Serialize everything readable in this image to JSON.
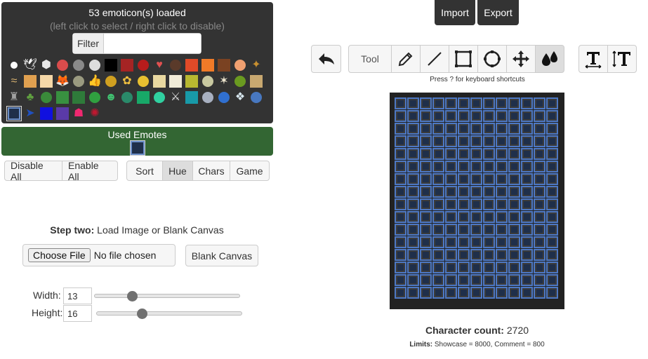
{
  "emotes": {
    "loaded_text": "53 emoticon(s) loaded",
    "hint_text": "(left click to select / right click to disable)",
    "filter_label": "Filter",
    "filter_value": "",
    "items": [
      {
        "name": "white-circle-emote",
        "shape": "sm",
        "color": "#ffffff"
      },
      {
        "name": "white-bird-emote",
        "shape": "glyph",
        "glyph": "🕊",
        "color": "#ffffff"
      },
      {
        "name": "white-cube-emote",
        "shape": "glyph",
        "glyph": "⬢",
        "color": "#e8e8e8"
      },
      {
        "name": "red-circle-emote",
        "shape": "ci",
        "color": "#d94c4c"
      },
      {
        "name": "grey-face-emote",
        "shape": "ci",
        "color": "#8a8a8a"
      },
      {
        "name": "panda-emote",
        "shape": "ci",
        "color": "#dddddd"
      },
      {
        "name": "black-square-emote",
        "shape": "sq",
        "color": "#000000"
      },
      {
        "name": "dark-red-square-emote",
        "shape": "sq",
        "color": "#a52424"
      },
      {
        "name": "red-swirl-emote",
        "shape": "ci",
        "color": "#b71c1c"
      },
      {
        "name": "heart-emote",
        "shape": "glyph",
        "glyph": "♥",
        "color": "#e05050"
      },
      {
        "name": "brown-dot-emote",
        "shape": "ci",
        "color": "#5a3a2a"
      },
      {
        "name": "orange-red-square-emote",
        "shape": "sq",
        "color": "#e04a28"
      },
      {
        "name": "orange-square-emote",
        "shape": "sq",
        "color": "#f07a28"
      },
      {
        "name": "brown-square-emote",
        "shape": "sq",
        "color": "#7a4222"
      },
      {
        "name": "peach-circle-emote",
        "shape": "ci",
        "color": "#f0a070"
      },
      {
        "name": "beetle-emote",
        "shape": "glyph",
        "glyph": "✦",
        "color": "#c89030"
      },
      {
        "name": "bone-emote",
        "shape": "glyph",
        "glyph": "≈",
        "color": "#d6b070"
      },
      {
        "name": "orange-tan-square-emote",
        "shape": "sq",
        "color": "#e0a050"
      },
      {
        "name": "cream-square-emote",
        "shape": "sq",
        "color": "#f5d8a8"
      },
      {
        "name": "fox-emote",
        "shape": "glyph",
        "glyph": "🦊",
        "color": "#d08030"
      },
      {
        "name": "grey-ball-emote",
        "shape": "ci",
        "color": "#9a9a80"
      },
      {
        "name": "thumbs-up-emote",
        "shape": "glyph",
        "glyph": "👍",
        "color": "#e0b030"
      },
      {
        "name": "yellow-creature-emote",
        "shape": "ci",
        "color": "#d0a020"
      },
      {
        "name": "duck-emote",
        "shape": "glyph",
        "glyph": "✿",
        "color": "#f0c040"
      },
      {
        "name": "yellow-circle-emote",
        "shape": "ci",
        "color": "#e8c030"
      },
      {
        "name": "parchment-emote",
        "shape": "sq",
        "color": "#e8d8a0"
      },
      {
        "name": "beige-square-emote",
        "shape": "sq",
        "color": "#f0ecd8"
      },
      {
        "name": "olive-square-emote",
        "shape": "sq",
        "color": "#b8b830"
      },
      {
        "name": "gear-emote",
        "shape": "ci",
        "color": "#c8c8a0"
      },
      {
        "name": "cat-emote",
        "shape": "glyph",
        "glyph": "✶",
        "color": "#f0e8d0"
      },
      {
        "name": "green-blob-emote",
        "shape": "ci",
        "color": "#6a9a20"
      },
      {
        "name": "tan-block-emote",
        "shape": "sq",
        "color": "#c8a870"
      },
      {
        "name": "robot-emote",
        "shape": "glyph",
        "glyph": "♜",
        "color": "#a0a0a0"
      },
      {
        "name": "plant-emote",
        "shape": "glyph",
        "glyph": "♣",
        "color": "#60a040"
      },
      {
        "name": "green-swirl-emote",
        "shape": "ci",
        "color": "#3a8a3a"
      },
      {
        "name": "green-square-emote",
        "shape": "sq",
        "color": "#389040"
      },
      {
        "name": "dark-green-square-emote",
        "shape": "sq",
        "color": "#2e7a3a"
      },
      {
        "name": "green-circle-emote",
        "shape": "ci",
        "color": "#30a040"
      },
      {
        "name": "green-alien-emote",
        "shape": "glyph",
        "glyph": "☻",
        "color": "#40c070"
      },
      {
        "name": "teal-face-emote",
        "shape": "ci",
        "color": "#2a8a6a"
      },
      {
        "name": "emerald-square-emote",
        "shape": "sq",
        "color": "#18a868"
      },
      {
        "name": "mint-circle-emote",
        "shape": "ci",
        "color": "#30d0a0"
      },
      {
        "name": "sword-emote",
        "shape": "glyph",
        "glyph": "⚔",
        "color": "#e0e0e0"
      },
      {
        "name": "teal-square-emote",
        "shape": "sq",
        "color": "#189aa8"
      },
      {
        "name": "silver-gear-emote",
        "shape": "ci",
        "color": "#a8b0c0"
      },
      {
        "name": "blue-ball-emote",
        "shape": "ci",
        "color": "#3070d0"
      },
      {
        "name": "bird-emote",
        "shape": "glyph",
        "glyph": "❖",
        "color": "#d8e8f0"
      },
      {
        "name": "blue-creature-emote",
        "shape": "ci",
        "color": "#4878c0"
      },
      {
        "name": "blue-frame-emote",
        "shape": "sq",
        "color": "#1f2f4a",
        "selected": true
      },
      {
        "name": "blue-hedgehog-emote",
        "shape": "glyph",
        "glyph": "➤",
        "color": "#2050c0"
      },
      {
        "name": "blue-square-emote",
        "shape": "sq",
        "color": "#1010e0"
      },
      {
        "name": "purple-square-emote",
        "shape": "sq",
        "color": "#5a3aa8"
      },
      {
        "name": "pink-ghost-emote",
        "shape": "glyph",
        "glyph": "☗",
        "color": "#f02870"
      },
      {
        "name": "red-spider-emote",
        "shape": "glyph",
        "glyph": "✺",
        "color": "#c01830"
      }
    ]
  },
  "used": {
    "title": "Used Emotes"
  },
  "toggle_buttons": {
    "disable_all": "Disable All",
    "enable_all": "Enable All"
  },
  "sort_buttons": {
    "sort": "Sort",
    "hue": "Hue",
    "chars": "Chars",
    "game": "Game",
    "active": "hue"
  },
  "step2": {
    "bold": "Step two:",
    "rest": " Load Image or Blank Canvas"
  },
  "file": {
    "choose_label": "Choose File",
    "status": "No file chosen"
  },
  "blank_canvas_label": "Blank Canvas",
  "dimensions": {
    "width_label": "Width:",
    "width_value": "13",
    "height_label": "Height:",
    "height_value": "16"
  },
  "top_buttons": {
    "import": "Import",
    "export": "Export"
  },
  "toolbar": {
    "tool_label": "Tool",
    "active_tool": "fill"
  },
  "shortcuts_hint": "Press ? for keyboard shortcuts",
  "canvas": {
    "columns": 13,
    "rows": 16
  },
  "stats": {
    "char_count_label": "Character count:",
    "char_count_value": "2720",
    "limits_label": "Limits:",
    "limits_value": "Showcase = 8000, Comment = 800"
  },
  "colors": {
    "panel_dark": "#333333",
    "used_green": "#336633",
    "cell_border": "#4d78c4"
  }
}
